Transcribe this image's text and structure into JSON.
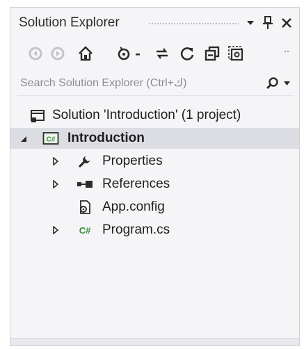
{
  "window": {
    "title": "Solution Explorer"
  },
  "titlebar_icons": [
    "dropdown-arrow-icon",
    "pin-icon",
    "close-icon"
  ],
  "toolbar": {
    "buttons": [
      "back-icon",
      "forward-icon",
      "home-icon",
      "pending-changes-filter-icon",
      "sync-with-active-document-icon",
      "refresh-icon",
      "collapse-all-icon",
      "show-all-files-icon"
    ]
  },
  "search": {
    "placeholder": "Search Solution Explorer (Ctrl+ك)"
  },
  "tree": {
    "solution": {
      "label": "Solution 'Introduction' (1 project)"
    },
    "project": {
      "label": "Introduction",
      "expanded": true,
      "selected": true
    },
    "items": [
      {
        "label": "Properties",
        "icon": "wrench-icon",
        "expandable": true
      },
      {
        "label": "References",
        "icon": "references-icon",
        "expandable": true
      },
      {
        "label": "App.config",
        "icon": "config-file-icon",
        "expandable": false
      },
      {
        "label": "Program.cs",
        "icon": "csharp-file-icon",
        "expandable": true
      }
    ]
  },
  "colors": {
    "panel_bg": "#f5f5f7",
    "selection": "#dcdde3",
    "csharp_green": "#3a8a3a",
    "toolbar_disabled": "#b8bac2"
  }
}
